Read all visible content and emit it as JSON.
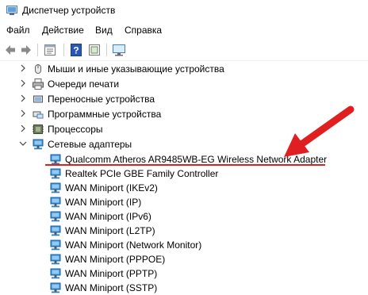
{
  "window": {
    "title": "Диспетчер устройств"
  },
  "menu": {
    "items": [
      "Файл",
      "Действие",
      "Вид",
      "Справка"
    ]
  },
  "toolbar": {
    "buttons": [
      "back-icon",
      "forward-icon",
      "properties-icon",
      "help-icon",
      "show-hidden-icon",
      "scan-hardware-icon"
    ]
  },
  "tree": {
    "categories": [
      {
        "label": "Мыши и иные указывающие устройства",
        "icon": "mouse-icon",
        "expanded": false
      },
      {
        "label": "Очереди печати",
        "icon": "printer-icon",
        "expanded": false
      },
      {
        "label": "Переносные устройства",
        "icon": "portable-device-icon",
        "expanded": false
      },
      {
        "label": "Программные устройства",
        "icon": "software-device-icon",
        "expanded": false
      },
      {
        "label": "Процессоры",
        "icon": "processor-icon",
        "expanded": false
      },
      {
        "label": "Сетевые адаптеры",
        "icon": "network-adapter-icon",
        "expanded": true
      }
    ],
    "network_adapters": [
      "Qualcomm Atheros AR9485WB-EG Wireless Network Adapter",
      "Realtek PCIe GBE Family Controller",
      "WAN Miniport (IKEv2)",
      "WAN Miniport (IP)",
      "WAN Miniport (IPv6)",
      "WAN Miniport (L2TP)",
      "WAN Miniport (Network Monitor)",
      "WAN Miniport (PPPOE)",
      "WAN Miniport (PPTP)",
      "WAN Miniport (SSTP)"
    ]
  },
  "annotation": {
    "color": "#e02020",
    "target": "Qualcomm Atheros AR9485WB-EG Wireless Network Adapter"
  }
}
